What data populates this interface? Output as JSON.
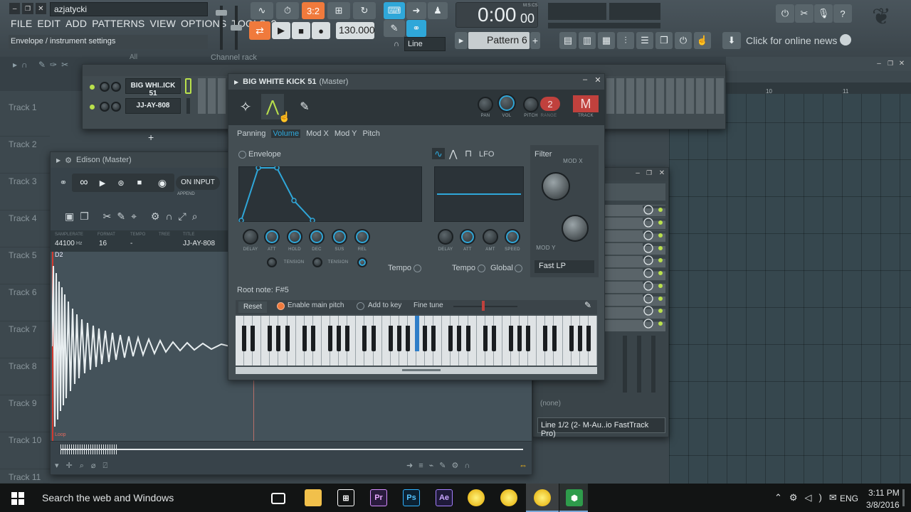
{
  "toolbar": {
    "project_name": "azjatycki",
    "menu": [
      "FILE",
      "EDIT",
      "ADD",
      "PATTERNS",
      "VIEW",
      "OPTIONS",
      "TOOLS",
      "?"
    ],
    "hint": "Envelope / instrument settings",
    "tempo": "130.000",
    "time": "0:00",
    "time_small": "00",
    "time_unit": "M:S:CS",
    "pattern": "Pattern 6",
    "snap": "Line",
    "news": "Click for online news"
  },
  "playlist": {
    "tracks": [
      "Track 1",
      "Track 2",
      "Track 3",
      "Track 4",
      "Track 5",
      "Track 6",
      "Track 7",
      "Track 8",
      "Track 9",
      "Track 10",
      "Track 11"
    ],
    "bar_numbers": [
      "10",
      "11"
    ]
  },
  "channel_rack": {
    "title": "Channel rack",
    "filter": "All",
    "channels": [
      "BIG WHI..ICK 51",
      "JJ-AY-808"
    ],
    "add": "+"
  },
  "edison": {
    "title": "Edison (Master)",
    "on_input": "ON INPUT",
    "append": "APPEND",
    "headers": [
      "SAMPLERATE",
      "FORMAT",
      "TEMPO",
      "TREE",
      "TITLE"
    ],
    "samplerate": "44100",
    "samplerate_unit": "Hz",
    "format": "16",
    "tempo": "-",
    "title_val": "JJ-AY-808",
    "marker": "D2",
    "loop": "Loop"
  },
  "mixer": {
    "none": "(none)",
    "input": "Line 1/2 (2- M-Au..io FastTrack Pro)"
  },
  "plugin": {
    "title": "BIG WHITE KICK 51",
    "title_suffix": "(Master)",
    "tabs": [
      "Panning",
      "Volume",
      "Mod X",
      "Mod Y",
      "Pitch"
    ],
    "active_tab": "Volume",
    "top_labels": {
      "pan": "PAN",
      "vol": "VOL",
      "pitch": "PITCH",
      "range": "RANGE",
      "track": "TRACK"
    },
    "range_value": "2",
    "track_value": "M",
    "envelope": "Envelope",
    "env_knobs": [
      "DELAY",
      "ATT",
      "HOLD",
      "DEC",
      "SUS",
      "REL"
    ],
    "tension": "TENSION",
    "tempo": "Tempo",
    "lfo": "LFO",
    "lfo_knobs": [
      "DELAY",
      "ATT",
      "AMT",
      "SPEED"
    ],
    "global": "Global",
    "filter": "Filter",
    "mod_x": "MOD X",
    "mod_y": "MOD Y",
    "filter_type": "Fast LP",
    "root_note": "Root note: F#5",
    "reset": "Reset",
    "enable_main_pitch": "Enable main pitch",
    "add_to_key": "Add to key",
    "fine_tune": "Fine tune",
    "octaves": [
      "C3",
      "C4",
      "C5",
      "C6",
      "C7",
      "C8"
    ]
  },
  "taskbar": {
    "search": "Search the web and Windows",
    "lang": "ENG",
    "time": "3:11 PM",
    "date": "3/8/2016"
  },
  "colors": {
    "accent": "#2fa7d9",
    "orange": "#f07a3c",
    "green": "#b9e04c",
    "red": "#c0413d"
  }
}
